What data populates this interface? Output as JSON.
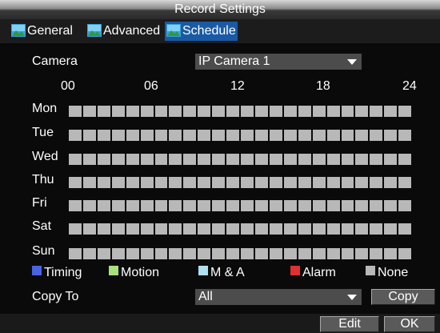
{
  "window": {
    "title": "Record Settings"
  },
  "tabs": [
    {
      "label": "General",
      "icon": "image-icon",
      "active": false
    },
    {
      "label": "Advanced",
      "icon": "image-icon",
      "active": false
    },
    {
      "label": "Schedule",
      "icon": "image-icon",
      "active": true
    }
  ],
  "camera": {
    "label": "Camera",
    "value": "IP Camera 1"
  },
  "hours": [
    "00",
    "06",
    "12",
    "18",
    "24"
  ],
  "days": [
    "Mon",
    "Tue",
    "Wed",
    "Thu",
    "Fri",
    "Sat",
    "Sun"
  ],
  "schedule": {
    "cells_per_day": 24,
    "default_mode": "None"
  },
  "legend": [
    {
      "label": "Timing",
      "color": "#4a63e0"
    },
    {
      "label": "Motion",
      "color": "#a8e07c"
    },
    {
      "label": "M & A",
      "color": "#aee0f2"
    },
    {
      "label": "Alarm",
      "color": "#e03030"
    },
    {
      "label": "None",
      "color": "#b8b8b8"
    }
  ],
  "copy_to": {
    "label": "Copy To",
    "value": "All",
    "button": "Copy"
  },
  "footer": {
    "edit": "Edit",
    "ok": "OK"
  }
}
